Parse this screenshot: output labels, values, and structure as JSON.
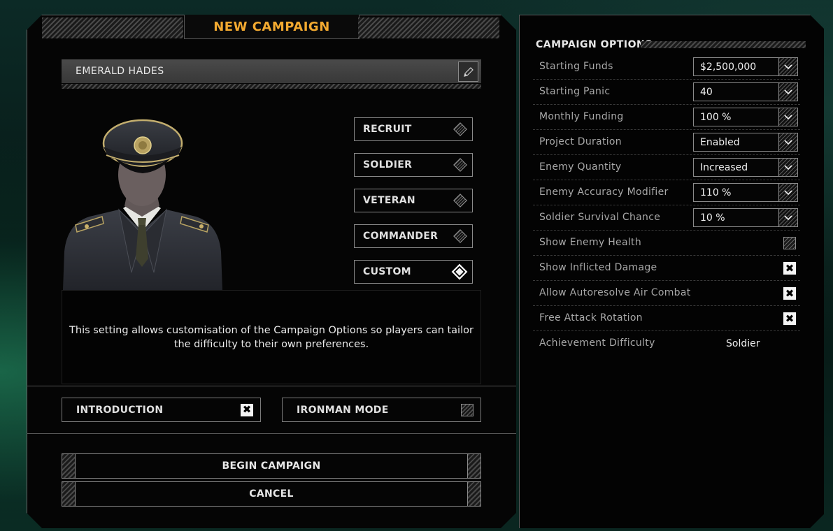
{
  "header": {
    "title": "NEW CAMPAIGN"
  },
  "commander": {
    "name": "EMERALD HADES"
  },
  "difficulty": {
    "options": [
      {
        "label": "RECRUIT",
        "selected": false
      },
      {
        "label": "SOLDIER",
        "selected": false
      },
      {
        "label": "VETERAN",
        "selected": false
      },
      {
        "label": "COMMANDER",
        "selected": false
      },
      {
        "label": "CUSTOM",
        "selected": true
      }
    ],
    "description": "This setting allows customisation of the Campaign Options so players can tailor the difficulty to their own preferences."
  },
  "toggles": {
    "introduction": {
      "label": "INTRODUCTION",
      "checked": true
    },
    "ironman": {
      "label": "IRONMAN MODE",
      "checked": false
    }
  },
  "actions": {
    "begin": "BEGIN CAMPAIGN",
    "cancel": "CANCEL"
  },
  "campaign_options": {
    "title": "CAMPAIGN OPTIONS",
    "rows": [
      {
        "label": "Starting Funds",
        "type": "select",
        "value": "$2,500,000"
      },
      {
        "label": "Starting Panic",
        "type": "select",
        "value": "40"
      },
      {
        "label": "Monthly Funding",
        "type": "select",
        "value": "100 %"
      },
      {
        "label": "Project Duration",
        "type": "select",
        "value": "Enabled"
      },
      {
        "label": "Enemy Quantity",
        "type": "select",
        "value": "Increased"
      },
      {
        "label": "Enemy Accuracy Modifier",
        "type": "select",
        "value": "110 %"
      },
      {
        "label": "Soldier Survival Chance",
        "type": "select",
        "value": "10 %"
      },
      {
        "label": "Show Enemy Health",
        "type": "checkbox",
        "checked": false
      },
      {
        "label": "Show Inflicted Damage",
        "type": "checkbox",
        "checked": true
      },
      {
        "label": "Allow Autoresolve Air Combat",
        "type": "checkbox",
        "checked": true
      },
      {
        "label": "Free Attack Rotation",
        "type": "checkbox",
        "checked": true
      },
      {
        "label": "Achievement Difficulty",
        "type": "static",
        "value": "Soldier"
      }
    ]
  },
  "icons": {
    "edit": "pencil-icon",
    "dropdown": "chevron-down-icon",
    "check_mark": "✖"
  },
  "colors": {
    "accent": "#f2a930",
    "panel": "#050505",
    "border": "#8a8a8a"
  }
}
